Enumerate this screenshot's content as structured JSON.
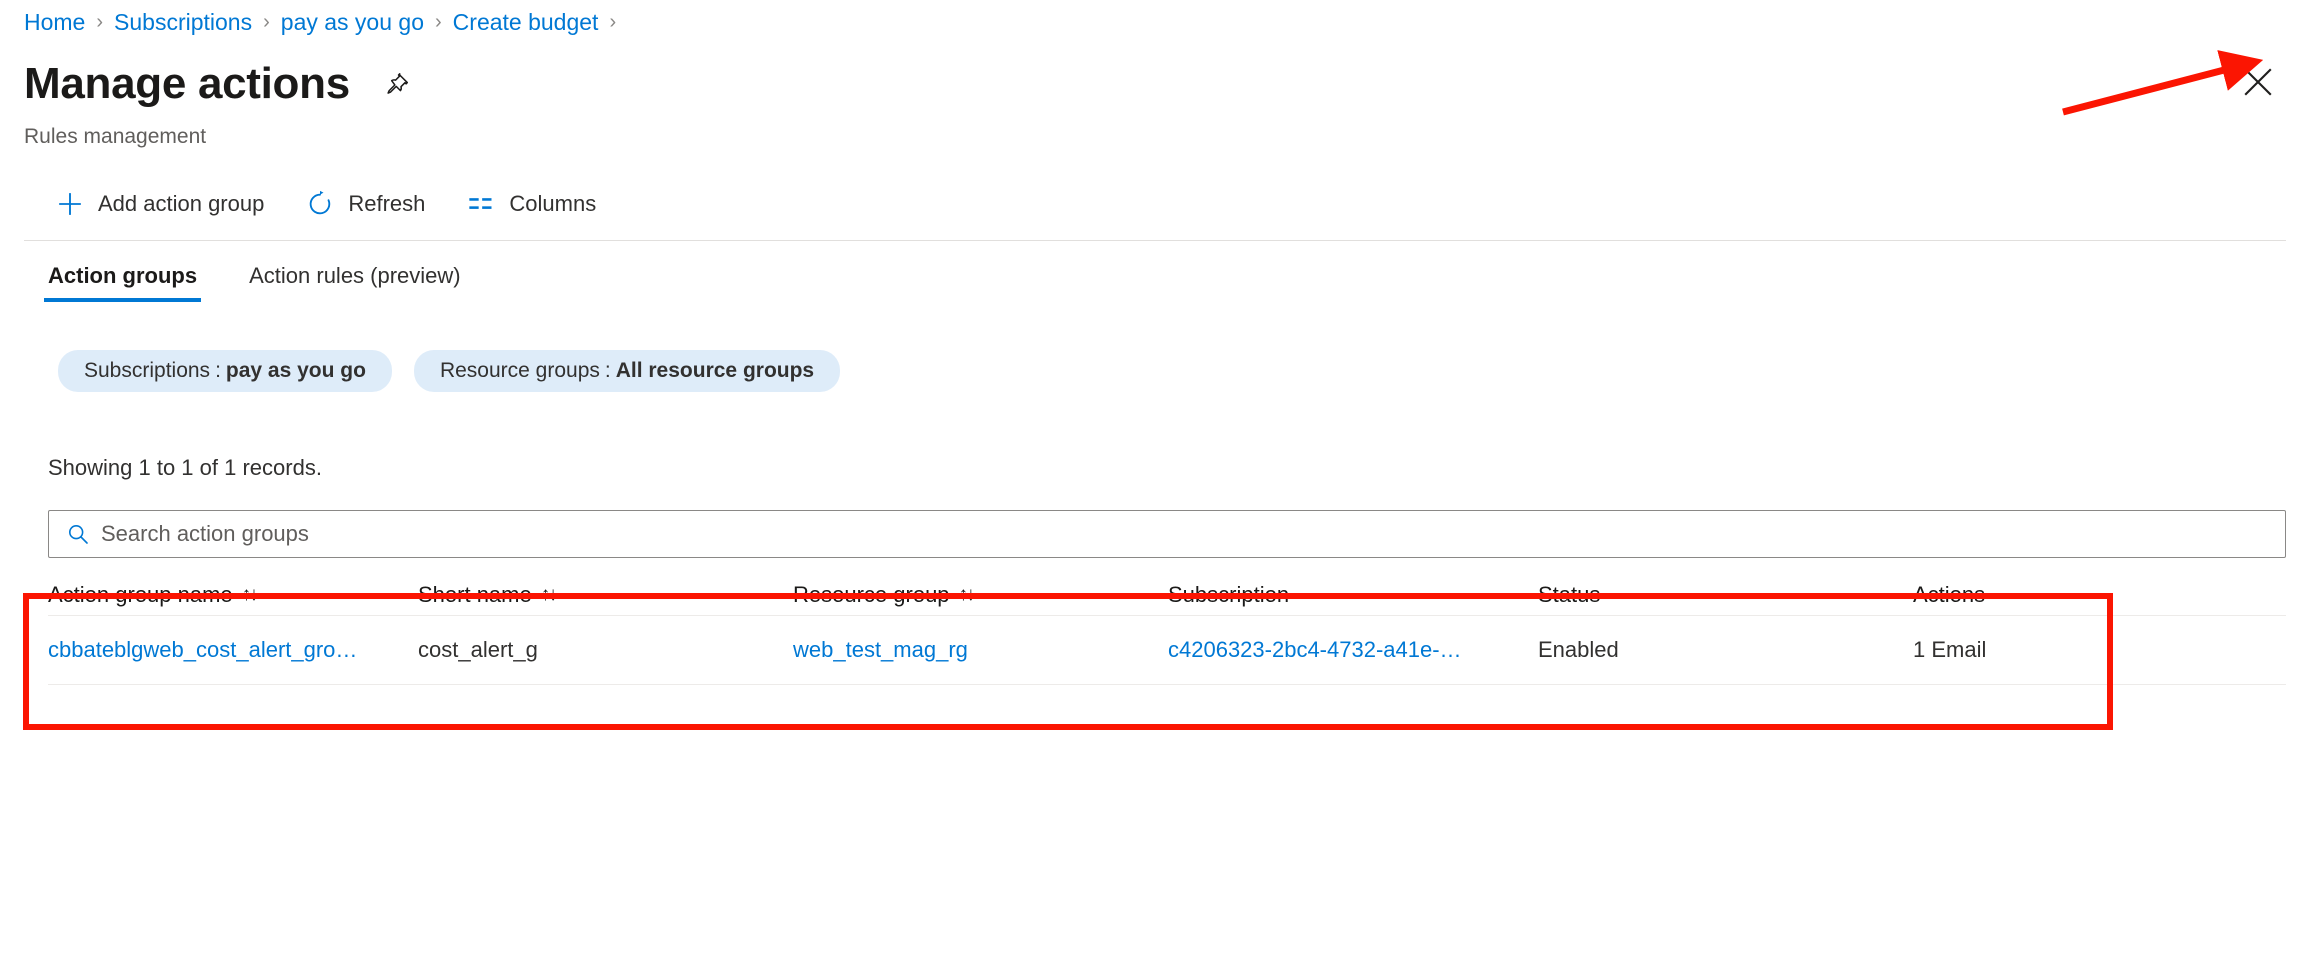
{
  "breadcrumb": {
    "separator": "›",
    "items": [
      {
        "label": "Home"
      },
      {
        "label": "Subscriptions"
      },
      {
        "label": "pay as you go"
      },
      {
        "label": "Create budget"
      }
    ]
  },
  "header": {
    "title": "Manage actions",
    "subtitle": "Rules management",
    "pin_icon": "pin-icon",
    "close_icon": "close-icon"
  },
  "command_bar": {
    "items": [
      {
        "label": "Add action group",
        "icon": "plus-icon"
      },
      {
        "label": "Refresh",
        "icon": "refresh-icon"
      },
      {
        "label": "Columns",
        "icon": "columns-icon"
      }
    ]
  },
  "tabs": [
    {
      "label": "Action groups",
      "selected": true
    },
    {
      "label": "Action rules (preview)",
      "selected": false
    }
  ],
  "filters": [
    {
      "key": "Subscriptions",
      "sep": ":",
      "value": "pay as you go"
    },
    {
      "key": "Resource groups",
      "sep": ":",
      "value": "All resource groups"
    }
  ],
  "records_text": "Showing 1 to 1 of 1 records.",
  "search": {
    "placeholder": "Search action groups",
    "value": "",
    "icon": "search-icon"
  },
  "table": {
    "sort_glyph": "↑↓",
    "columns": [
      {
        "label": "Action group name",
        "sortable": true
      },
      {
        "label": "Short name",
        "sortable": true
      },
      {
        "label": "Resource group",
        "sortable": true
      },
      {
        "label": "Subscription",
        "sortable": false
      },
      {
        "label": "Status",
        "sortable": false
      },
      {
        "label": "Actions",
        "sortable": false
      }
    ],
    "rows": [
      {
        "action_group_name": "cbbateblgweb_cost_alert_gro…",
        "short_name": "cost_alert_g",
        "resource_group": "web_test_mag_rg",
        "subscription": "c4206323-2bc4-4732-a41e-…",
        "status": "Enabled",
        "actions": "1 Email"
      }
    ]
  },
  "annotations": {
    "highlight_color": "#fb1502",
    "arrow_target": "close-icon"
  }
}
